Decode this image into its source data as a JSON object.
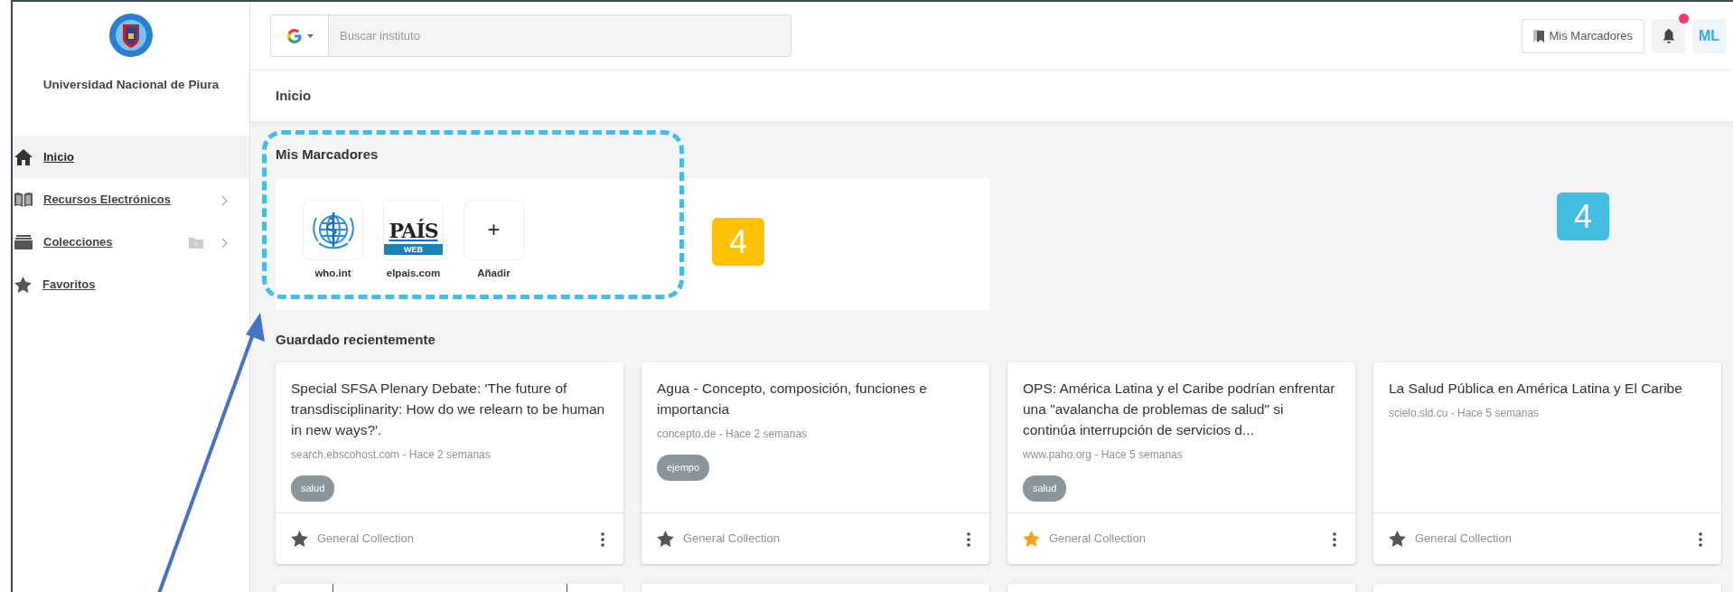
{
  "sidebar": {
    "institution": "Universidad Nacional de Piura",
    "items": [
      {
        "label": "Inicio",
        "selected": true,
        "submenu": false,
        "add_folder": false
      },
      {
        "label": "Recursos Electrónicos",
        "selected": false,
        "submenu": true,
        "add_folder": false
      },
      {
        "label": "Colecciones",
        "selected": false,
        "submenu": true,
        "add_folder": true
      },
      {
        "label": "Favoritos",
        "selected": false,
        "submenu": false,
        "add_folder": false
      }
    ]
  },
  "topbar": {
    "search": {
      "placeholder": "Buscar instituto"
    },
    "bookmarks_button": "Mis Marcadores",
    "notification_unread": true,
    "avatar": "ML"
  },
  "breadcrumb": "Inicio",
  "bookmarks": {
    "title": "Mis Marcadores",
    "items": [
      {
        "label": "who.int",
        "kind": "emblem"
      },
      {
        "label": "elpais.com",
        "kind": "wordmark",
        "logo_text": "PAÍS",
        "logo_subtext": "WEB"
      },
      {
        "label": "Añadir",
        "kind": "add",
        "symbol": "+"
      }
    ]
  },
  "recent": {
    "title": "Guardado recientemente",
    "cards": [
      {
        "title": "Special SFSA Plenary Debate: 'The future of transdisciplinarity: How do we relearn to be human in new ways?'.",
        "source": "search.ebscohost.com - Hace 2 semanas",
        "tags": [
          "salud"
        ],
        "favorite": false,
        "collection": "General Collection"
      },
      {
        "title": "Agua - Concepto, composición, funciones e importancia",
        "source": "concepto.de - Hace 2 semanas",
        "tags": [
          "ejempo"
        ],
        "favorite": false,
        "collection": "General Collection"
      },
      {
        "title": "OPS: América Latina y el Caribe podrían enfrentar una \"avalancha de problemas de salud\" si continúa interrupción de servicios d...",
        "source": "www.paho.org - Hace 5 semanas",
        "tags": [
          "salud"
        ],
        "favorite": true,
        "collection": "General Collection"
      },
      {
        "title": "La Salud Pública en América Latina y El Caribe",
        "source": "scielo.sld.cu - Hace 5 semanas",
        "favorite": false,
        "collection": "General Collection"
      }
    ],
    "partial_cards": [
      {
        "kind": "document"
      },
      {
        "kind": "blank"
      },
      {
        "kind": "blank"
      },
      {
        "kind": "blank"
      }
    ]
  },
  "annotations": [
    {
      "text": "4",
      "color": "#ffc000"
    },
    {
      "text": "4",
      "color": "#45bde3"
    }
  ]
}
